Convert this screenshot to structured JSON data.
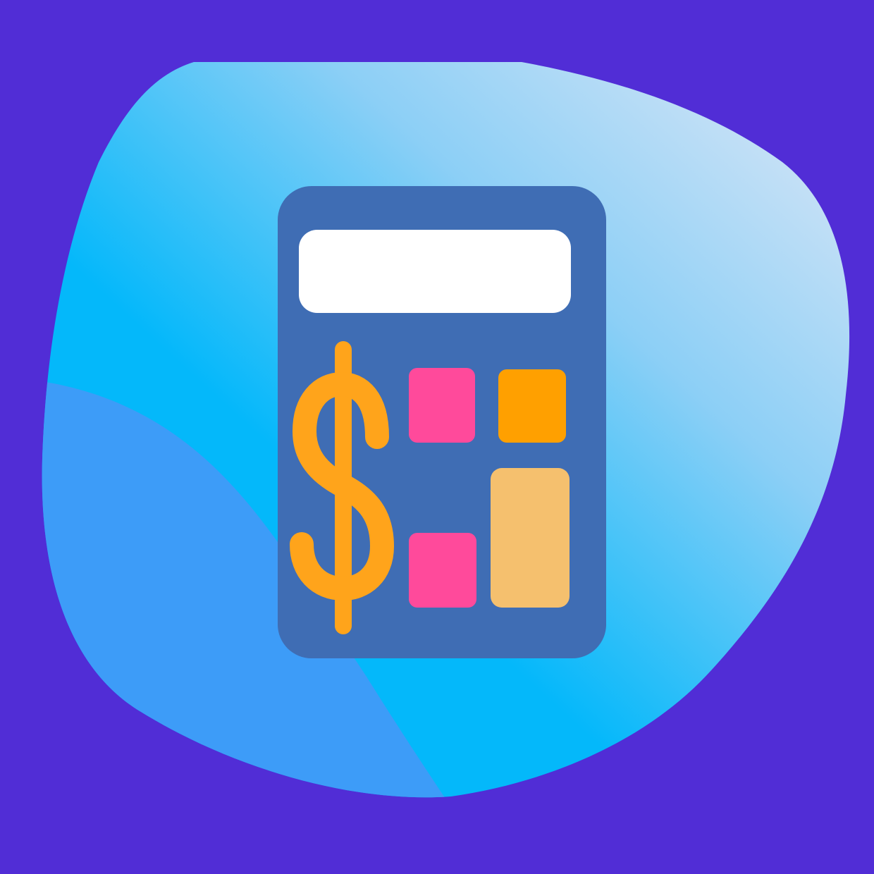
{
  "icon": {
    "name": "calculator-dollar-icon",
    "colors": {
      "background": "#512dd6",
      "blob_light": "#dfe8f6",
      "blob_mid": "#8ccff6",
      "blob_sky": "#04b8fa",
      "blob_shade": "#3d9cf8",
      "calculator_body": "#3f6db4",
      "display": "#ffffff",
      "dollar": "#ffa41b",
      "key_pink": "#ff4a9b",
      "key_orange": "#ffa000",
      "key_peach": "#f5c06e"
    }
  }
}
